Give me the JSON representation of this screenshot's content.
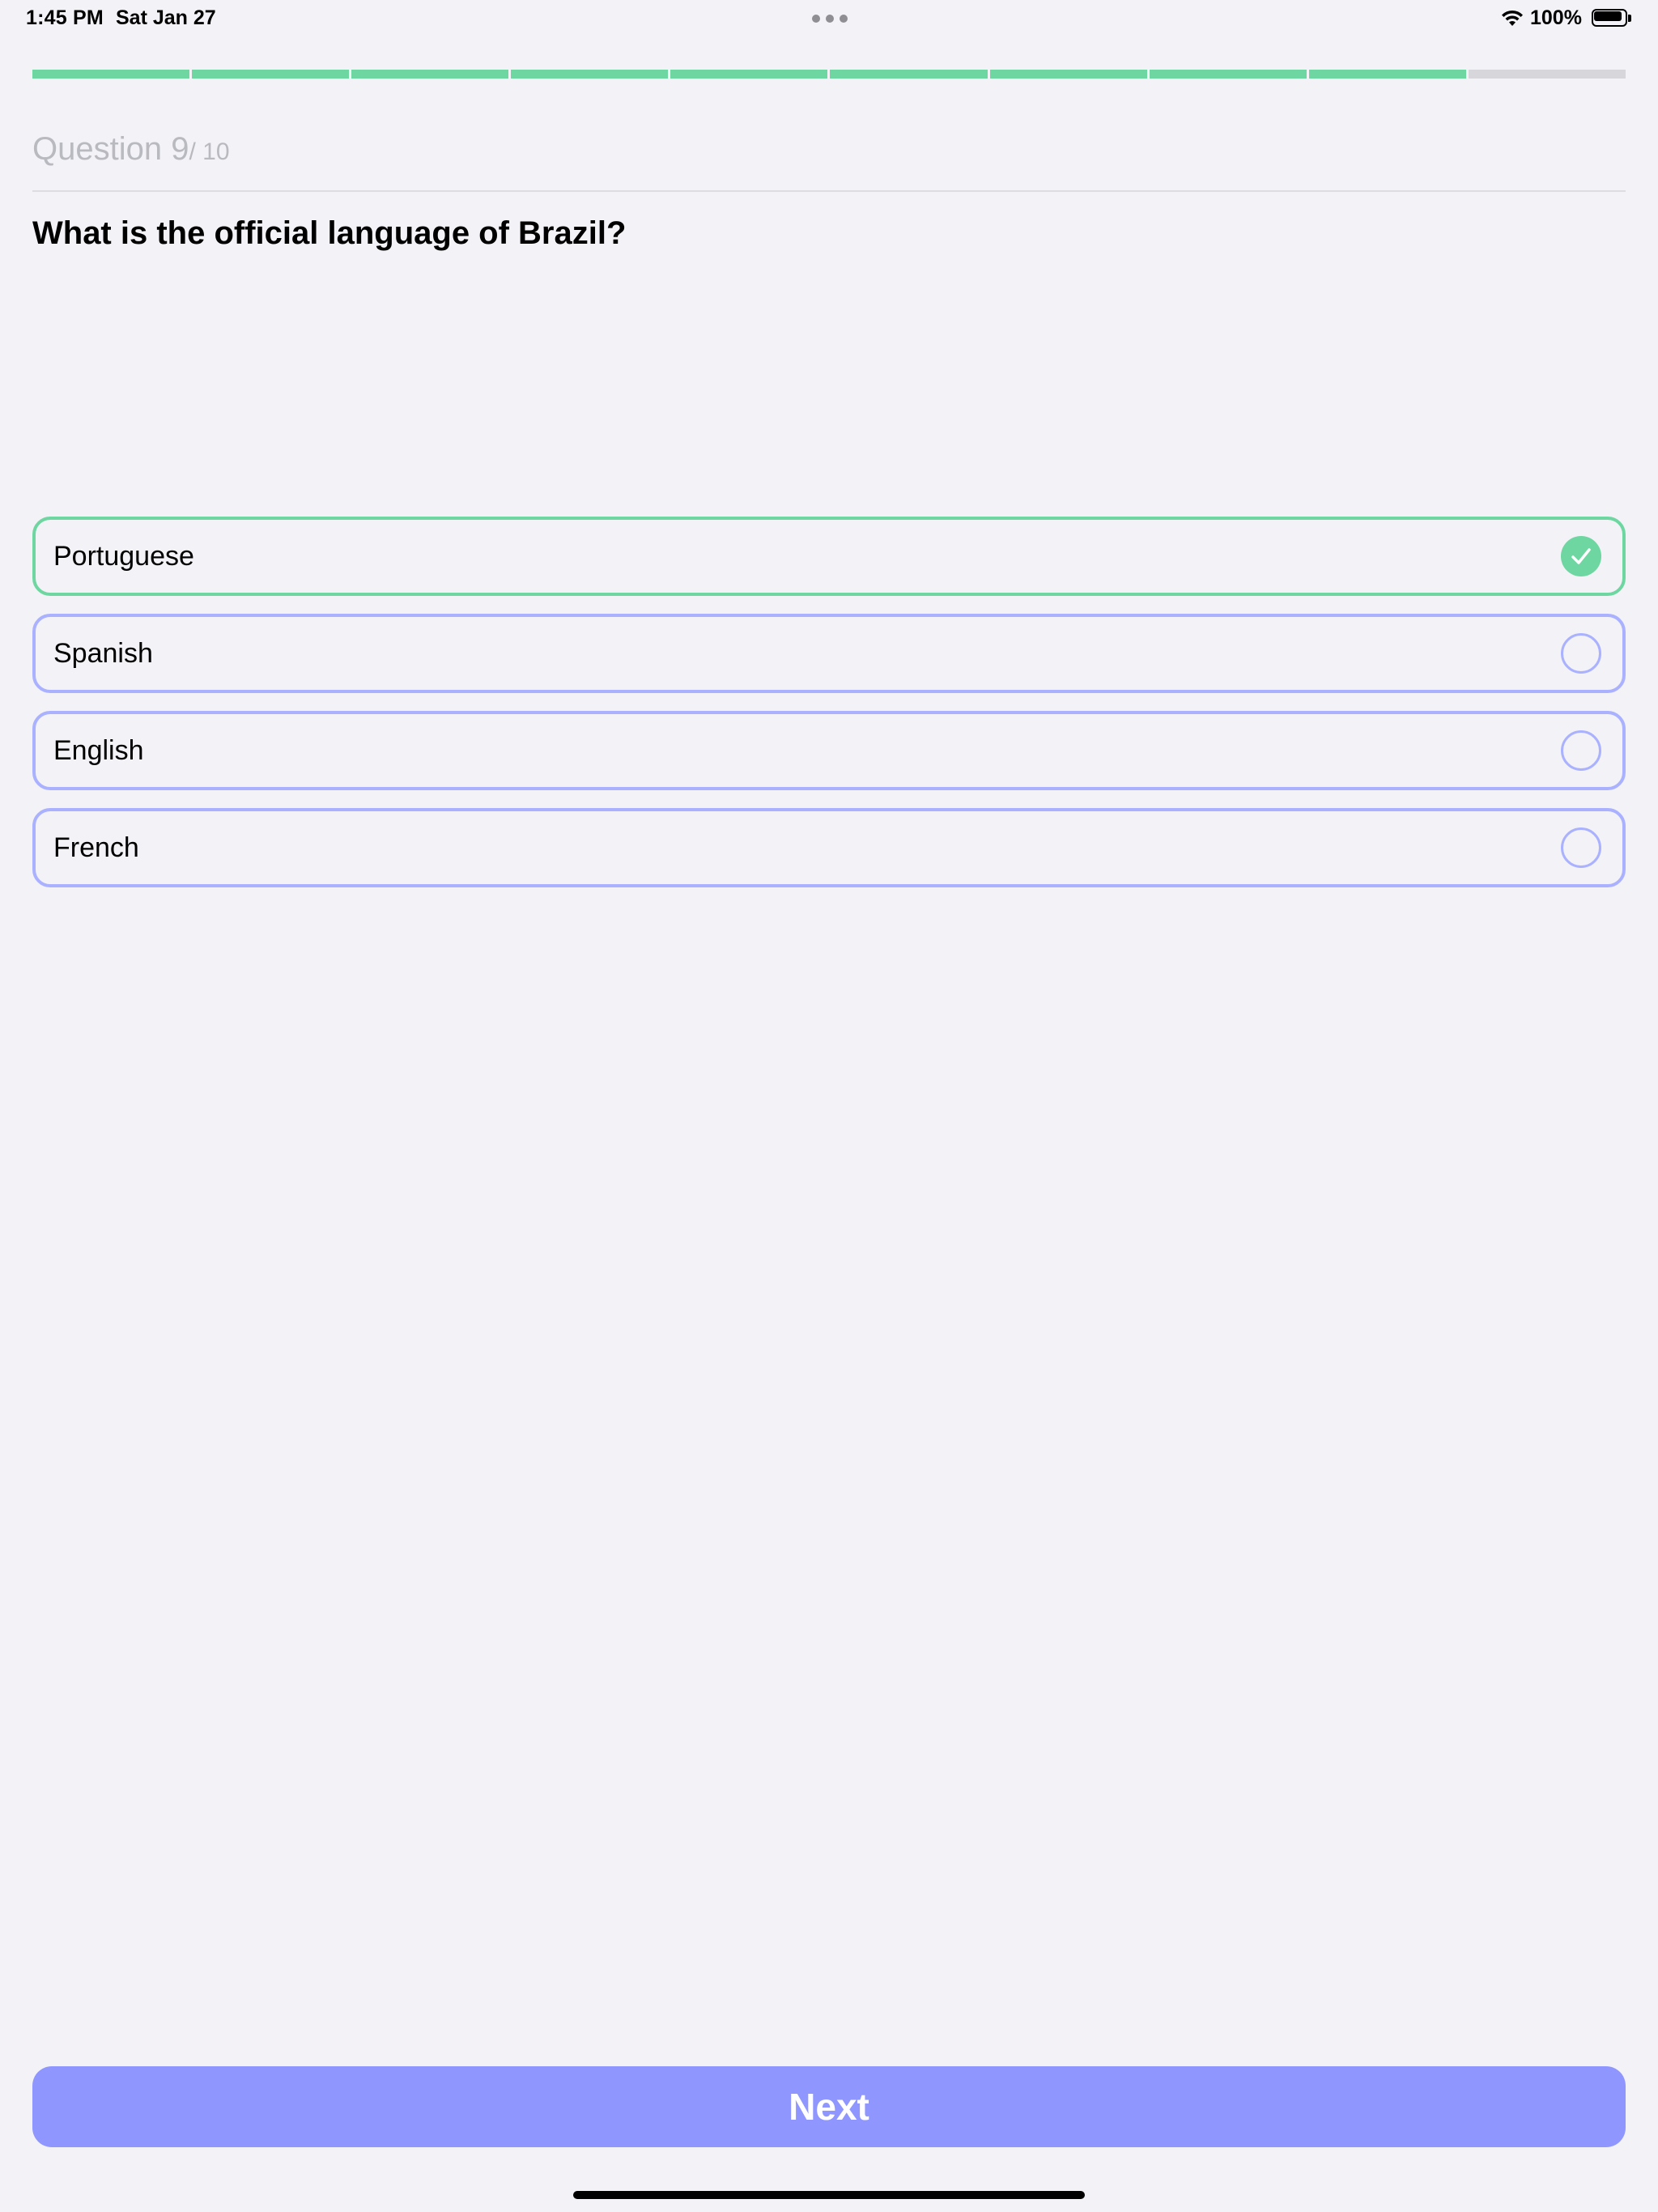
{
  "status_bar": {
    "time": "1:45 PM",
    "date": "Sat Jan 27",
    "battery": "100%"
  },
  "progress": {
    "total_segments": 10,
    "completed_segments": 9,
    "fill_color": "#6ed6a0",
    "track_color": "#d6d6db"
  },
  "header": {
    "question_label": "Question 9",
    "question_total": "/ 10"
  },
  "question": {
    "text": "What is the official language of Brazil?"
  },
  "answers": [
    {
      "label": "Portuguese",
      "selected": true
    },
    {
      "label": "Spanish",
      "selected": false
    },
    {
      "label": "English",
      "selected": false
    },
    {
      "label": "French",
      "selected": false
    }
  ],
  "colors": {
    "accent": "#8f97ff",
    "selected": "#6ed6a0",
    "option_border": "#aab2ff",
    "background": "#f2f2f7"
  },
  "next_button": {
    "label": "Next"
  }
}
